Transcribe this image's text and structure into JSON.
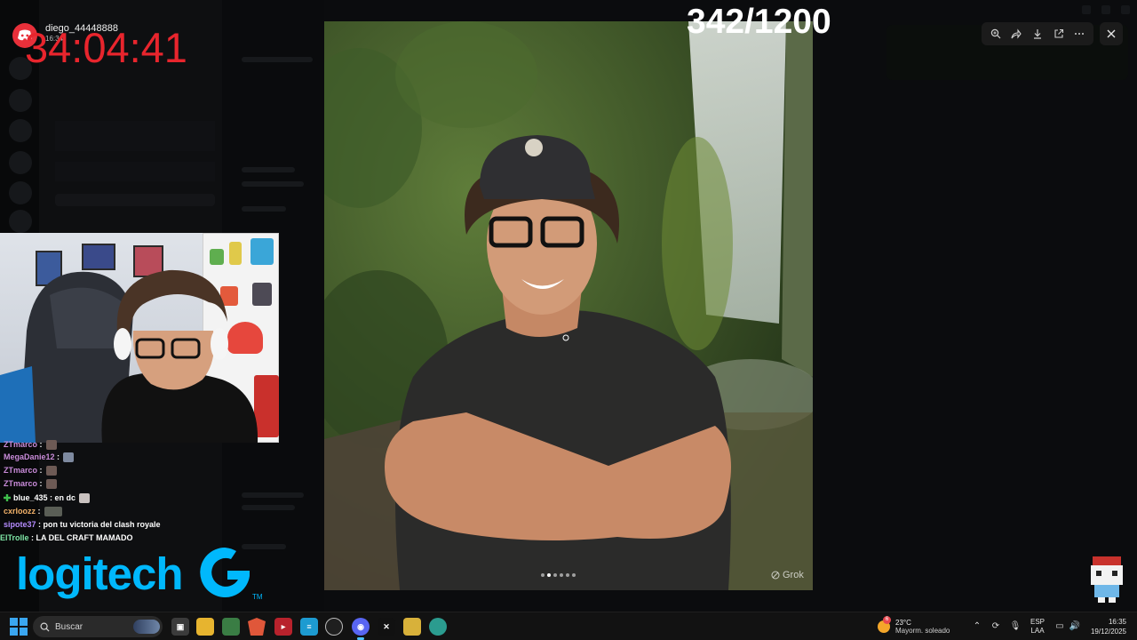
{
  "stream_overlay": {
    "discord_username": "diego_44448888",
    "discord_sub": "16:34",
    "timer": "34:04:41",
    "counter": "342/1200",
    "brand_text": "logitech",
    "brand_mark": "TM"
  },
  "chat": {
    "messages": [
      {
        "user": "ZTmarco",
        "text": "",
        "user_color": "#c98bd9",
        "emote": true
      },
      {
        "user": "MegaDanie12",
        "text": "",
        "user_color": "#c98bd9",
        "emote": true
      },
      {
        "user": "ZTmarco",
        "text": "",
        "user_color": "#c98bd9",
        "emote": true
      },
      {
        "user": "ZTmarco",
        "text": "",
        "user_color": "#c98bd9",
        "emote": true
      },
      {
        "user": "blue_435",
        "text": "en dc",
        "user_color": "#ffffff",
        "emote": true,
        "badge": true
      },
      {
        "user": "cxrloozz",
        "text": "",
        "user_color": "#f4b36a",
        "emote": true
      },
      {
        "user": "sipote37",
        "text": "pon tu victoria del clash royale",
        "user_color": "#b58cff",
        "emote": false
      },
      {
        "user": "ElTrolle",
        "text": "LA DEL CRAFT MAMADO",
        "user_color": "#7fe6a6",
        "emote": false
      }
    ]
  },
  "viewer": {
    "toolbar": {
      "zoom_icon": "zoom-icon",
      "share_icon": "share-icon",
      "download_icon": "download-icon",
      "open_icon": "open-external-icon",
      "more_icon": "more-icon"
    },
    "close_icon": "close-icon",
    "page_dots": 6,
    "active_dot": 2,
    "watermark": "Grok"
  },
  "taskbar": {
    "search_label": "Buscar",
    "weather_temp": "23°C",
    "weather_desc": "Mayorm. soleado",
    "weather_badge": "6",
    "lang_line1": "ESP",
    "lang_line2": "LAA",
    "time": "16:35",
    "date": "19/12/2025",
    "accent": "#4cc2ff"
  },
  "colors": {
    "timer_red": "#e8252d",
    "logitech_blue": "#00b8fc",
    "discord_red": "#e8303a"
  }
}
